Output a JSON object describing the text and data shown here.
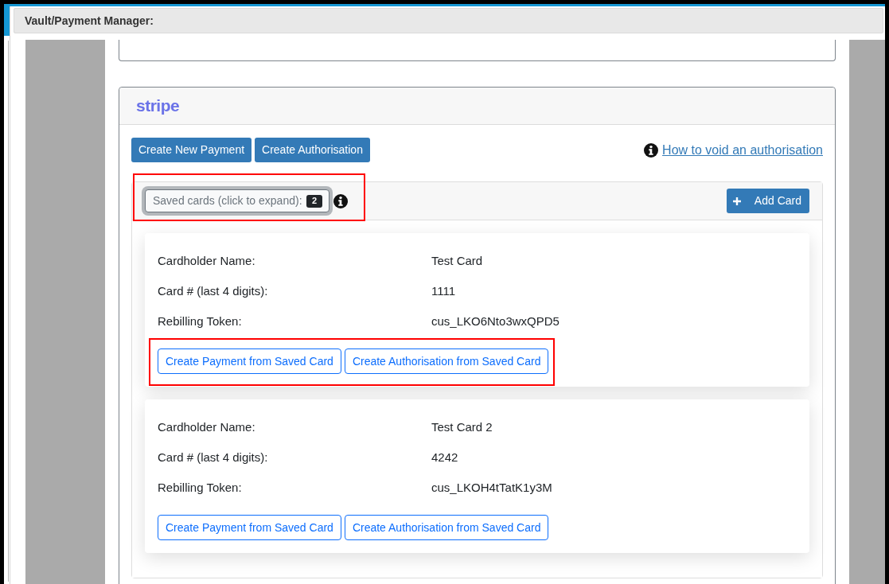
{
  "dialog": {
    "title": "Vault/Payment Manager:"
  },
  "stripe_panel": {
    "logo": "stripe",
    "buttons": [
      "Create New Payment",
      "Create Authorisation"
    ],
    "help_link": "How to void an authorisation",
    "saved_cards": {
      "label": "Saved cards (click to expand):",
      "count": "2",
      "focused": true,
      "highlighted": true,
      "add_button": "Add Card",
      "cards": [
        {
          "fields": [
            {
              "label": "Cardholder Name:",
              "value": "Test Card"
            },
            {
              "label": "Card # (last 4 digits):",
              "value": "1111"
            },
            {
              "label": "Rebilling Token:",
              "value": "cus_LKO6Nto3wxQPD5"
            }
          ],
          "actions": [
            "Create Payment from Saved Card",
            "Create Authorisation from Saved Card"
          ],
          "actions_highlighted": true
        },
        {
          "fields": [
            {
              "label": "Cardholder Name:",
              "value": "Test Card 2"
            },
            {
              "label": "Card # (last 4 digits):",
              "value": "4242"
            },
            {
              "label": "Rebilling Token:",
              "value": "cus_LKOH4tTatK1y3M"
            }
          ],
          "actions": [
            "Create Payment from Saved Card",
            "Create Authorisation from Saved Card"
          ],
          "actions_highlighted": false
        }
      ]
    }
  }
}
